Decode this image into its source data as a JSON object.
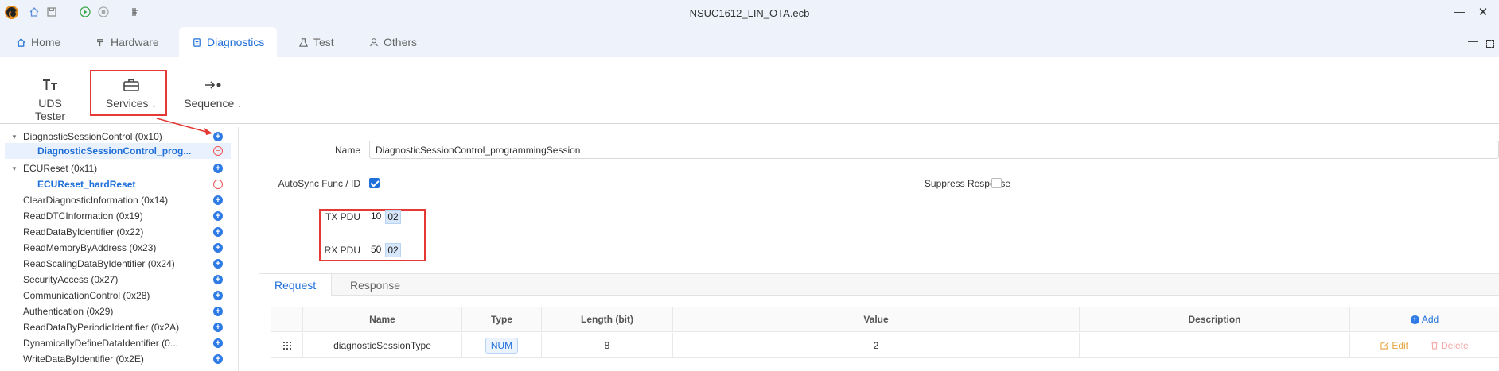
{
  "window": {
    "title": "NSUC1612_LIN_OTA.ecb"
  },
  "tabs": [
    {
      "label": "Home",
      "icon": "home-icon"
    },
    {
      "label": "Hardware",
      "icon": "hammer-icon"
    },
    {
      "label": "Diagnostics",
      "icon": "diagnostics-icon",
      "active": true
    },
    {
      "label": "Test",
      "icon": "flask-icon"
    },
    {
      "label": "Others",
      "icon": "user-icon"
    }
  ],
  "ribbon": {
    "uds_tester": "UDS Tester",
    "services": "Services",
    "sequence": "Sequence"
  },
  "tree": [
    {
      "label": "DiagnosticSessionControl (0x10)",
      "expanded": true,
      "action": "add"
    },
    {
      "label": "DiagnosticSessionControl_prog...",
      "child": true,
      "selected": true,
      "action": "remove"
    },
    {
      "label": "ECUReset (0x11)",
      "expanded": true,
      "action": "add"
    },
    {
      "label": "ECUReset_hardReset",
      "child": true,
      "action": "remove"
    },
    {
      "label": "ClearDiagnosticInformation (0x14)",
      "action": "add"
    },
    {
      "label": "ReadDTCInformation (0x19)",
      "action": "add"
    },
    {
      "label": "ReadDataByIdentifier (0x22)",
      "action": "add"
    },
    {
      "label": "ReadMemoryByAddress (0x23)",
      "action": "add"
    },
    {
      "label": "ReadScalingDataByIdentifier (0x24)",
      "action": "add"
    },
    {
      "label": "SecurityAccess (0x27)",
      "action": "add"
    },
    {
      "label": "CommunicationControl (0x28)",
      "action": "add"
    },
    {
      "label": "Authentication (0x29)",
      "action": "add"
    },
    {
      "label": "ReadDataByPeriodicIdentifier (0x2A)",
      "action": "add"
    },
    {
      "label": "DynamicallyDefineDataIdentifier (0...",
      "action": "add"
    },
    {
      "label": "WriteDataByIdentifier (0x2E)",
      "action": "add"
    }
  ],
  "form": {
    "name_label": "Name",
    "name_value": "DiagnosticSessionControl_programmingSession",
    "autosync_label": "AutoSync Func / ID",
    "autosync_checked": true,
    "suppress_label": "Suppress Response",
    "suppress_checked": false,
    "tx_label": "TX PDU",
    "tx_bytes": [
      "10",
      "02"
    ],
    "rx_label": "RX PDU",
    "rx_bytes": [
      "50",
      "02"
    ]
  },
  "subtabs": {
    "request": "Request",
    "response": "Response"
  },
  "table": {
    "headers": {
      "name": "Name",
      "type": "Type",
      "length": "Length (bit)",
      "value": "Value",
      "description": "Description",
      "add": "Add"
    },
    "rows": [
      {
        "name": "diagnosticSessionType",
        "type": "NUM",
        "length": "8",
        "value": "2",
        "description": "",
        "edit": "Edit",
        "delete": "Delete"
      }
    ]
  },
  "colors": {
    "accent": "#1f6fd9",
    "highlight_box": "#e53935",
    "tab_bg": "#eef3fb"
  }
}
